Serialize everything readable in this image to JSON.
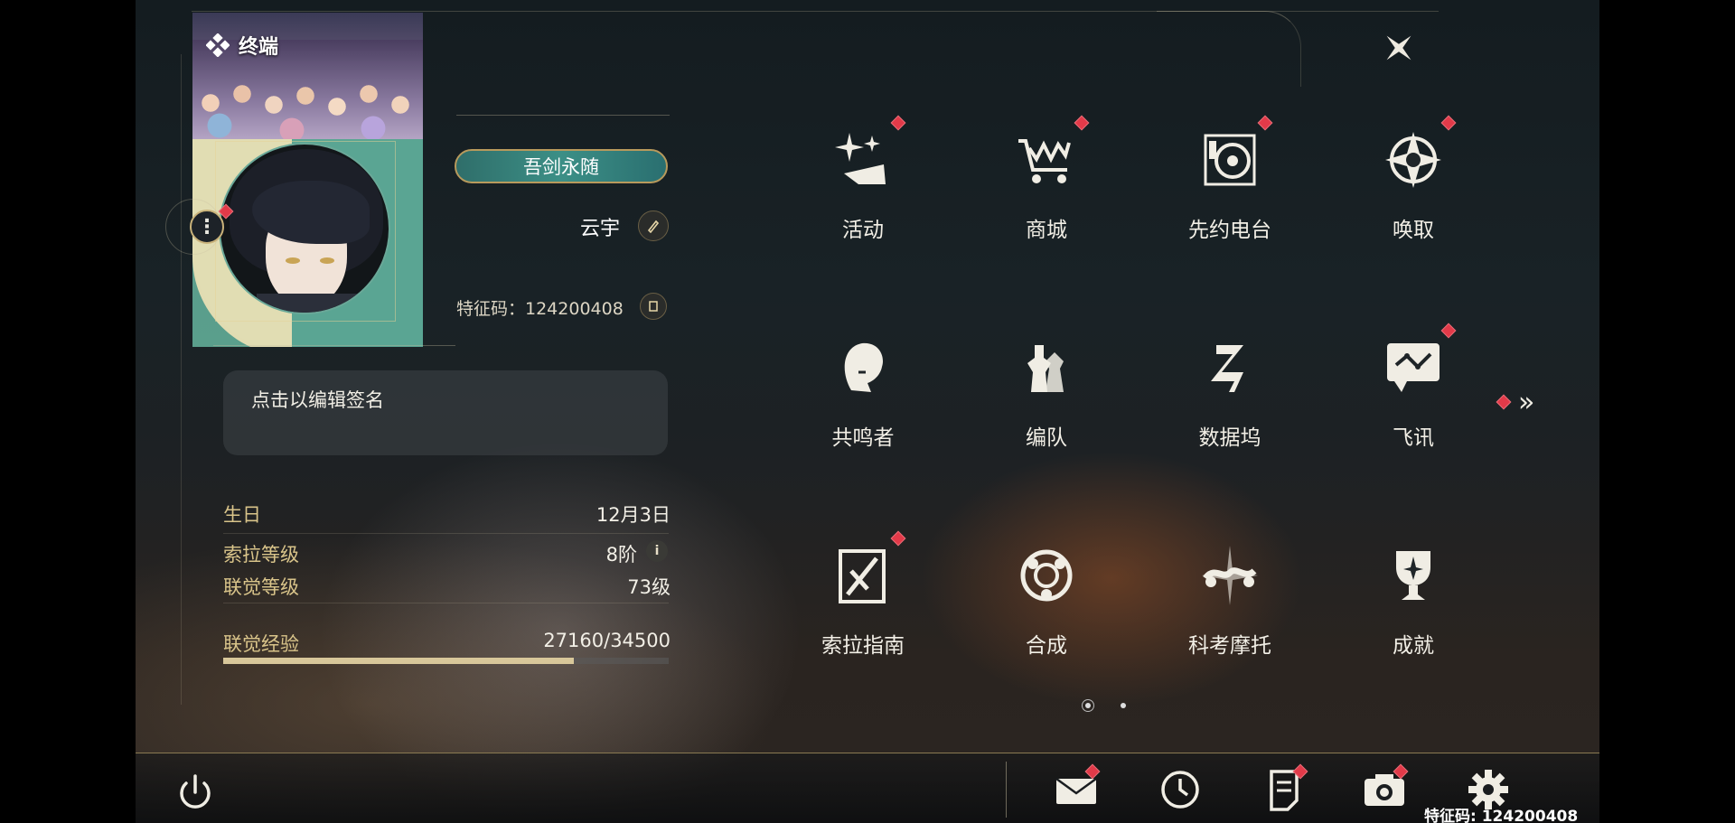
{
  "header": {
    "terminal_title": "终端"
  },
  "profile": {
    "title_badge": "吾剑永随",
    "player_name": "云宇",
    "feature_code": "特征码：124200408",
    "signature_placeholder": "点击以编辑签名",
    "stats": [
      {
        "label": "生日",
        "value": "12月3日"
      },
      {
        "label": "索拉等级",
        "value": "8阶"
      },
      {
        "label": "联觉等级",
        "value": "73级"
      },
      {
        "label": "联觉经验",
        "value": "27160/34500"
      }
    ],
    "exp_current": 27160,
    "exp_max": 34500
  },
  "menu": [
    {
      "label": "活动",
      "icon": "sparkle-activity-icon",
      "badge": true
    },
    {
      "label": "商城",
      "icon": "shop-cart-icon",
      "badge": true
    },
    {
      "label": "先约电台",
      "icon": "radio-icon",
      "badge": true
    },
    {
      "label": "唤取",
      "icon": "compass-star-icon",
      "badge": true
    },
    {
      "label": "共鸣者",
      "icon": "character-head-icon",
      "badge": false
    },
    {
      "label": "编队",
      "icon": "chess-team-icon",
      "badge": false
    },
    {
      "label": "数据坞",
      "icon": "data-dock-icon",
      "badge": false
    },
    {
      "label": "飞讯",
      "icon": "message-screen-icon",
      "badge": true
    },
    {
      "label": "索拉指南",
      "icon": "guide-icon",
      "badge": true
    },
    {
      "label": "合成",
      "icon": "synthesis-icon",
      "badge": false
    },
    {
      "label": "科考摩托",
      "icon": "motorbike-icon",
      "badge": false
    },
    {
      "label": "成就",
      "icon": "trophy-icon",
      "badge": false
    }
  ],
  "pagination": {
    "pages": 2,
    "current": 1
  },
  "footer": {
    "uid_text": "特征码: 124200408",
    "icons": [
      "mail-icon",
      "clock-icon",
      "notes-icon",
      "camera-icon",
      "settings-gear-icon"
    ]
  },
  "colors": {
    "badge_red": "#e23a49",
    "accent_gold": "#d9c48a",
    "teal": "#3c8f86"
  }
}
